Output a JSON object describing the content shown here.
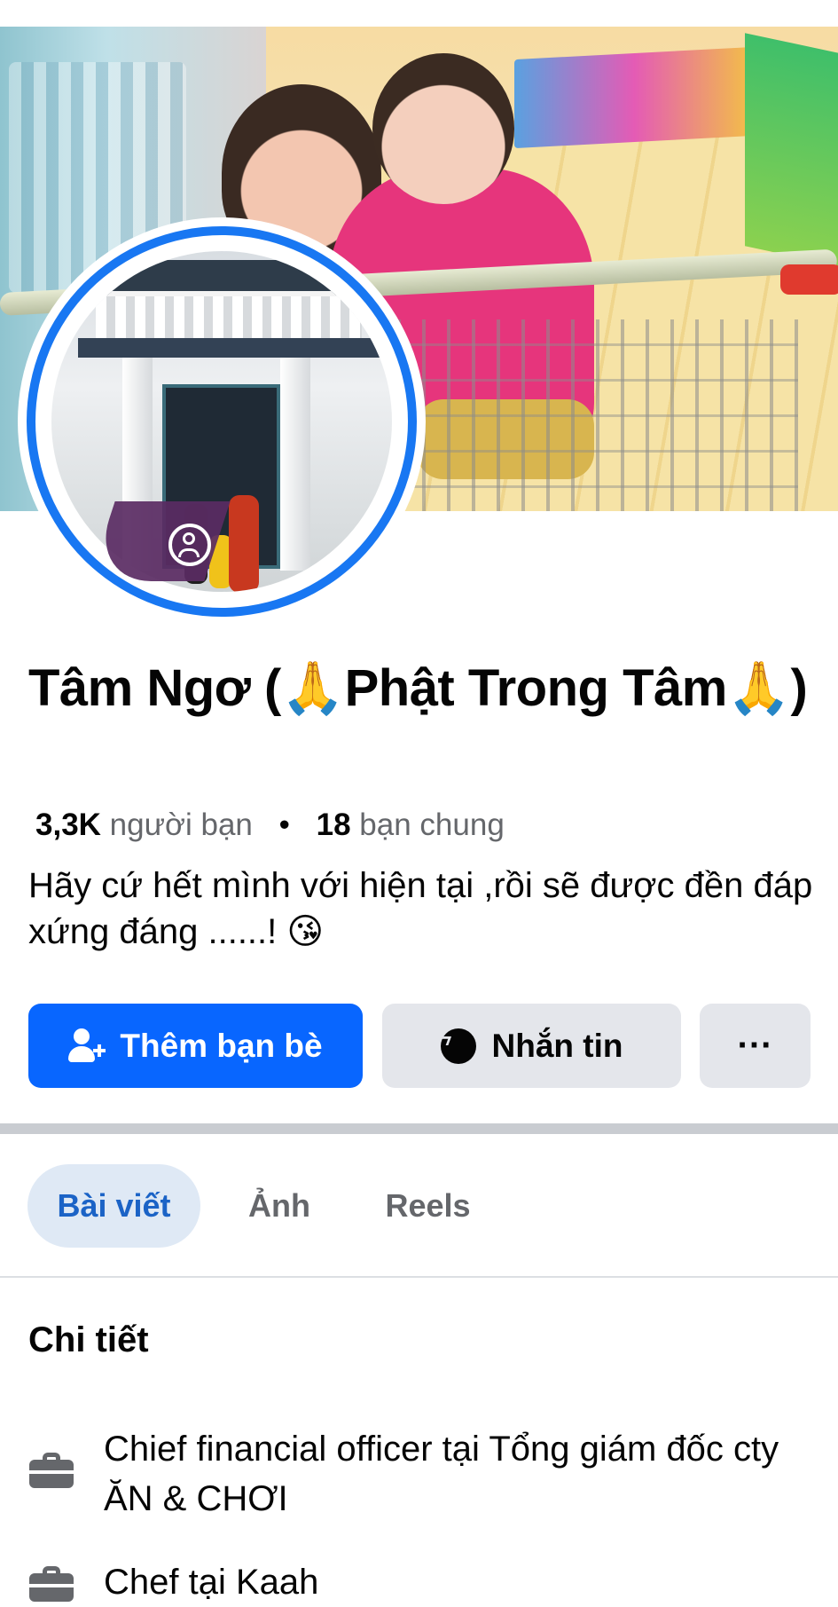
{
  "profile": {
    "name": "Tâm Ngơ (🙏Phật Trong Tâm🙏)",
    "friends_count": "3,3K",
    "friends_label": "người bạn",
    "separator": "•",
    "mutual_count": "18",
    "mutual_label": "bạn chung",
    "bio": "Hãy cứ hết mình với hiện tại ,rồi sẽ được đền đáp xứng đáng ......! 😘"
  },
  "actions": {
    "add_friend_label": "Thêm bạn bè",
    "message_label": "Nhắn tin",
    "more_label": "···",
    "add_friend_icon": "add-friend-icon",
    "message_icon": "messenger-icon"
  },
  "tabs": [
    {
      "label": "Bài viết",
      "active": true
    },
    {
      "label": "Ảnh",
      "active": false
    },
    {
      "label": "Reels",
      "active": false
    }
  ],
  "details": {
    "title": "Chi tiết",
    "items": [
      {
        "icon": "briefcase-icon",
        "text": "Chief financial officer tại Tổng giám đốc cty ĂN & CHƠI"
      },
      {
        "icon": "briefcase-icon",
        "text": "Chef tại Kaah"
      }
    ]
  },
  "colors": {
    "primary_button": "#0866ff",
    "secondary_button": "#e4e6eb",
    "active_tab_bg": "#dfe9f5",
    "active_tab_text": "#1b63c6",
    "profile_ring": "#1877f2"
  }
}
